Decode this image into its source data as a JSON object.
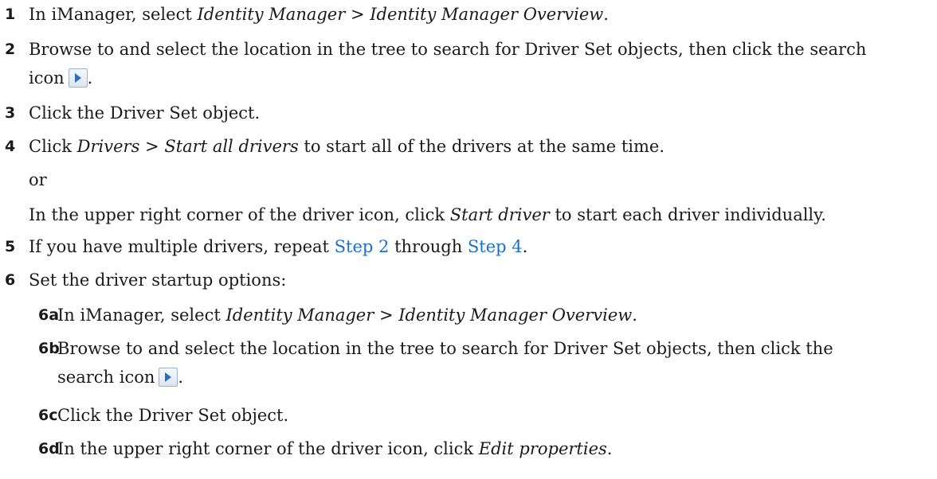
{
  "steps": {
    "s1": {
      "num": "1",
      "a": "In iManager, select ",
      "b": "Identity Manager > Identity Manager Overview",
      "c": "."
    },
    "s2": {
      "num": "2",
      "line1": "Browse to and select the location in the tree to search for Driver Set objects, then click the search",
      "line2": "icon",
      "end": "."
    },
    "s3": {
      "num": "3",
      "text": "Click the Driver Set object."
    },
    "s4": {
      "num": "4",
      "a": "Click ",
      "b": "Drivers > Start all drivers",
      "c": " to start all of the drivers at the same time.",
      "or": "or",
      "alt_a": "In the upper right corner of the driver icon, click ",
      "alt_b": "Start driver",
      "alt_c": " to start each driver individually."
    },
    "s5": {
      "num": "5",
      "a": "If you have multiple drivers, repeat ",
      "link1": "Step 2",
      "b": " through ",
      "link2": "Step 4",
      "c": "."
    },
    "s6": {
      "num": "6",
      "text": "Set the driver startup options:"
    },
    "s6a": {
      "num": "6a",
      "a": "In iManager, select ",
      "b": "Identity Manager > Identity Manager Overview",
      "c": "."
    },
    "s6b": {
      "num": "6b",
      "line1": "Browse to and select the location in the tree to search for Driver Set objects, then click the",
      "line2": "search icon",
      "end": "."
    },
    "s6c": {
      "num": "6c",
      "text": "Click the Driver Set object."
    },
    "s6d": {
      "num": "6d",
      "a": "In the upper right corner of the driver icon, click ",
      "b": "Edit properties",
      "c": "."
    }
  },
  "icons": {
    "search": "search-arrow-icon",
    "accent": "#1a6fd0"
  }
}
